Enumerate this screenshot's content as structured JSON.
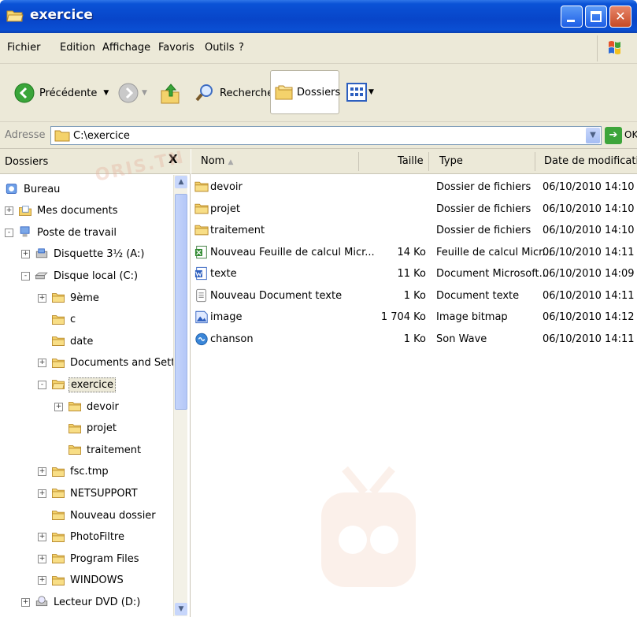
{
  "window": {
    "title": "exercice"
  },
  "menu": [
    "Fichier",
    "Edition",
    "Affichage",
    "Favoris",
    "Outils",
    "?"
  ],
  "toolbar": {
    "back_label": "Précédente",
    "search_label": "Rechercher",
    "folders_label": "Dossiers"
  },
  "address": {
    "label": "Adresse",
    "value": "C:\\exercice",
    "go_label": "OK"
  },
  "folders_pane": {
    "title": "Dossiers",
    "close_label": "X",
    "watermark": "ORIS.TN",
    "tree": [
      {
        "label": "Bureau",
        "icon": "desktop-icon"
      },
      {
        "label": "Mes documents",
        "icon": "my-documents-icon"
      },
      {
        "label": "Poste de travail",
        "icon": "my-computer-icon"
      },
      {
        "label": "Disquette 3½ (A:)",
        "icon": "floppy-drive-icon"
      },
      {
        "label": "Disque local (C:)",
        "icon": "hard-drive-icon"
      },
      {
        "label": "9ème",
        "icon": "folder-icon"
      },
      {
        "label": "c",
        "icon": "folder-icon"
      },
      {
        "label": "date",
        "icon": "folder-icon"
      },
      {
        "label": "Documents and Settir",
        "icon": "folder-icon"
      },
      {
        "label": "exercice",
        "icon": "folder-open-icon"
      },
      {
        "label": "devoir",
        "icon": "folder-icon"
      },
      {
        "label": "projet",
        "icon": "folder-icon"
      },
      {
        "label": "traitement",
        "icon": "folder-icon"
      },
      {
        "label": "fsc.tmp",
        "icon": "folder-icon"
      },
      {
        "label": "NETSUPPORT",
        "icon": "folder-icon"
      },
      {
        "label": "Nouveau dossier",
        "icon": "folder-icon"
      },
      {
        "label": "PhotoFiltre",
        "icon": "folder-icon"
      },
      {
        "label": "Program Files",
        "icon": "folder-icon"
      },
      {
        "label": "WINDOWS",
        "icon": "folder-icon"
      },
      {
        "label": "Lecteur DVD (D:)",
        "icon": "dvd-drive-icon"
      }
    ]
  },
  "list": {
    "columns": [
      "Nom",
      "Taille",
      "Type",
      "Date de modification"
    ],
    "rows": [
      {
        "name": "devoir",
        "size": "",
        "type": "Dossier de fichiers",
        "date": "06/10/2010 14:10",
        "icon": "folder-icon"
      },
      {
        "name": "projet",
        "size": "",
        "type": "Dossier de fichiers",
        "date": "06/10/2010 14:10",
        "icon": "folder-icon"
      },
      {
        "name": "traitement",
        "size": "",
        "type": "Dossier de fichiers",
        "date": "06/10/2010 14:10",
        "icon": "folder-icon"
      },
      {
        "name": "Nouveau Feuille de calcul Micr...",
        "size": "14 Ko",
        "type": "Feuille de calcul Micr...",
        "date": "06/10/2010 14:11",
        "icon": "excel-file-icon"
      },
      {
        "name": "texte",
        "size": "11 Ko",
        "type": "Document Microsoft...",
        "date": "06/10/2010 14:09",
        "icon": "word-file-icon"
      },
      {
        "name": "Nouveau Document texte",
        "size": "1 Ko",
        "type": "Document texte",
        "date": "06/10/2010 14:11",
        "icon": "text-file-icon"
      },
      {
        "name": "image",
        "size": "1 704 Ko",
        "type": "Image bitmap",
        "date": "06/10/2010 14:12",
        "icon": "bitmap-file-icon"
      },
      {
        "name": "chanson",
        "size": "1 Ko",
        "type": "Son Wave",
        "date": "06/10/2010 14:11",
        "icon": "wave-file-icon"
      }
    ]
  },
  "colors": {
    "titlebar_blue": "#0a52d6",
    "chrome_beige": "#ece9d8",
    "folder_yellow": "#f4d26b",
    "close_red": "#c64a25"
  }
}
